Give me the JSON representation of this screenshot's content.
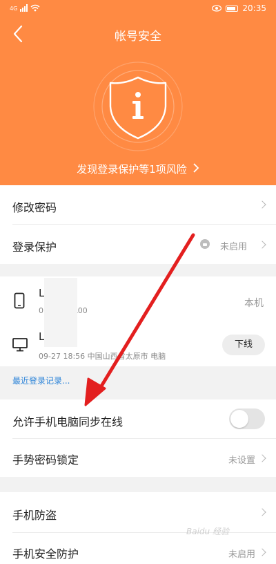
{
  "status_bar": {
    "network": "4G",
    "time": "20:35"
  },
  "header": {
    "title": "帐号安全",
    "risk_text": "发现登录保护等1项风险",
    "accent": "#ff8a43"
  },
  "settings1": [
    {
      "label": "修改密码"
    },
    {
      "label": "登录保护",
      "value": "未启用"
    }
  ],
  "devices": {
    "items": [
      {
        "name": "L        0",
        "sub": "0          6 LIO-AL00",
        "tag": "本机",
        "icon": "phone-icon"
      },
      {
        "name": "L        0",
        "sub": "09-27 18:56 中国山西省太原市 电脑",
        "action": "下线",
        "icon": "monitor-icon"
      }
    ],
    "recent_link": "最近登录记录..."
  },
  "settings2": [
    {
      "label": "允许手机电脑同步在线",
      "toggle": false
    },
    {
      "label": "手势密码锁定",
      "value": "未设置"
    }
  ],
  "settings3": [
    {
      "label": "手机防盗"
    },
    {
      "label": "手机安全防护",
      "value": "未启用"
    }
  ],
  "watermark": "Baidu 经验"
}
